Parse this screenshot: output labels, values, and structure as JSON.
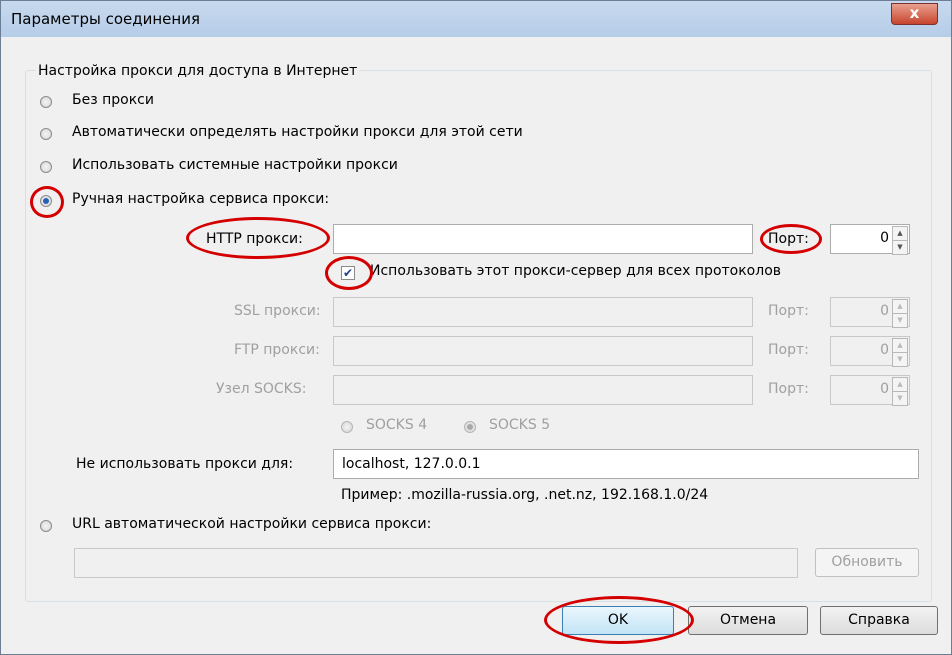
{
  "window": {
    "title": "Параметры соединения",
    "close_glyph": "x"
  },
  "group": {
    "legend": "Настройка прокси для доступа в Интернет"
  },
  "radios": {
    "no_proxy": "Без прокси",
    "auto_detect": "Автоматически определять настройки прокси для этой сети",
    "system": "Использовать системные настройки прокси",
    "manual": "Ручная настройка сервиса прокси:",
    "auto_url": "URL автоматической настройки сервиса прокси:"
  },
  "manual": {
    "http_label": "HTTP прокси:",
    "http_value": "",
    "port_label": "Порт:",
    "http_port": "0",
    "use_all_label": "Использовать этот прокси-сервер для всех протоколов",
    "ssl_label": "SSL прокси:",
    "ftp_label": "FTP прокси:",
    "socks_label": "Узел SOCKS:",
    "ssl_port": "0",
    "ftp_port": "0",
    "socks_port": "0",
    "socks4": "SOCKS 4",
    "socks5": "SOCKS 5",
    "no_proxy_label": "Не использовать прокси для:",
    "no_proxy_value": "localhost, 127.0.0.1",
    "example": "Пример: .mozilla-russia.org, .net.nz, 192.168.1.0/24"
  },
  "auto_url": {
    "value": "",
    "reload_label": "Обновить"
  },
  "buttons": {
    "ok": "OK",
    "cancel": "Отмена",
    "help": "Справка"
  },
  "colors": {
    "annotation": "#d40000",
    "accent": "#2860b8"
  }
}
